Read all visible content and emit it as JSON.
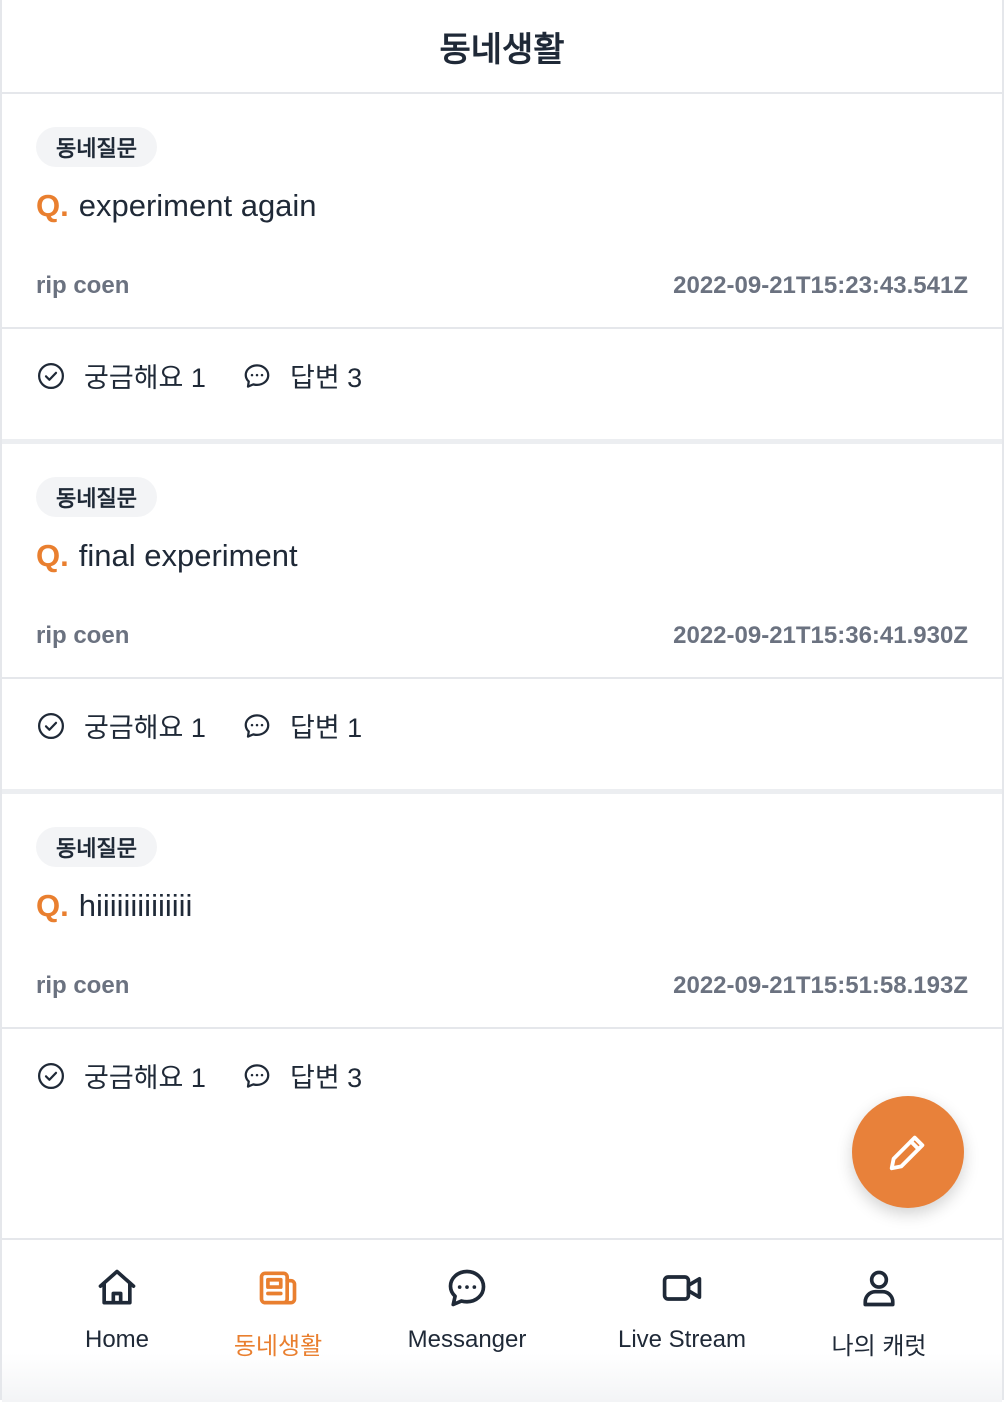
{
  "header": {
    "title": "동네생활"
  },
  "posts": [
    {
      "tag": "동네질문",
      "q": "Q.",
      "title": "experiment again",
      "author": "rip coen",
      "time": "2022-09-21T15:23:43.541Z",
      "curious": "궁금해요 1",
      "answers": "답변 3"
    },
    {
      "tag": "동네질문",
      "q": "Q.",
      "title": "final experiment",
      "author": "rip coen",
      "time": "2022-09-21T15:36:41.930Z",
      "curious": "궁금해요 1",
      "answers": "답변 1"
    },
    {
      "tag": "동네질문",
      "q": "Q.",
      "title": "hiiiiiiiiiiiiii",
      "author": "rip coen",
      "time": "2022-09-21T15:51:58.193Z",
      "curious": "궁금해요 1",
      "answers": "답변 3"
    }
  ],
  "fab": {
    "icon": "pencil-icon",
    "color": "#e8813a"
  },
  "tabbar": {
    "items": [
      {
        "label": "Home",
        "icon": "home-icon"
      },
      {
        "label": "동네생활",
        "icon": "newspaper-icon",
        "active": true
      },
      {
        "label": "Messanger",
        "icon": "chat-icon"
      },
      {
        "label": "Live Stream",
        "icon": "video-icon"
      },
      {
        "label": "나의 캐럿",
        "icon": "user-icon"
      }
    ]
  },
  "colors": {
    "accent": "#e97f2f",
    "muted": "#6b7280",
    "text": "#1f2937"
  }
}
